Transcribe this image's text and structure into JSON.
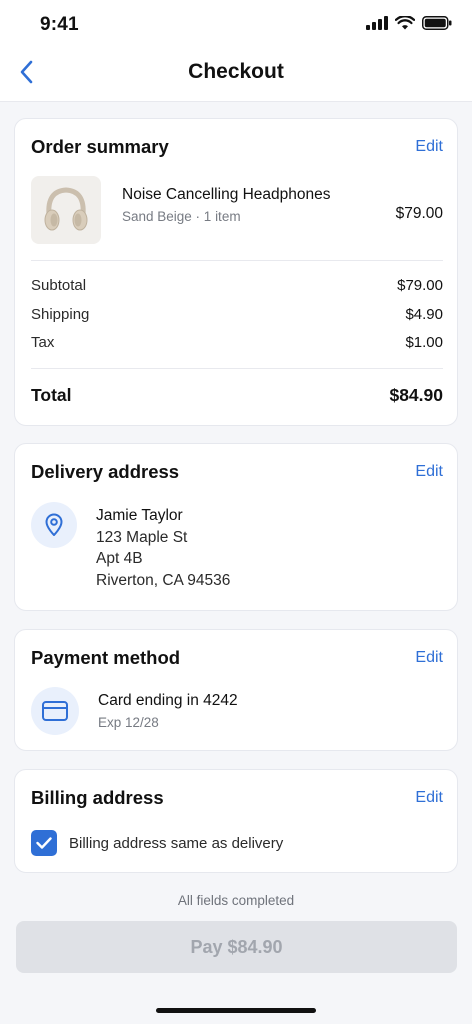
{
  "status_bar": {
    "time": "9:41"
  },
  "nav": {
    "title": "Checkout"
  },
  "order_summary": {
    "title": "Order summary",
    "edit_label": "Edit",
    "item": {
      "name": "Noise Cancelling Headphones",
      "variant": "Sand Beige · 1 item",
      "price": "$79.00"
    },
    "lines": [
      {
        "label": "Subtotal",
        "value": "$79.00"
      },
      {
        "label": "Shipping",
        "value": "$4.90"
      },
      {
        "label": "Tax",
        "value": "$1.00"
      }
    ],
    "total": {
      "label": "Total",
      "value": "$84.90"
    }
  },
  "delivery": {
    "title": "Delivery address",
    "edit_label": "Edit",
    "name": "Jamie Taylor",
    "line1": "123 Maple St",
    "line2": "Apt 4B",
    "line3": "Riverton, CA 94536",
    "icon": "location-pin-icon"
  },
  "payment": {
    "title": "Payment method",
    "edit_label": "Edit",
    "card": "Card ending in 4242",
    "exp": "Exp 12/28",
    "icon": "credit-card-icon"
  },
  "billing": {
    "title": "Billing address",
    "edit_label": "Edit",
    "same_as_delivery_label": "Billing address same as delivery",
    "same_as_delivery": true
  },
  "footer": {
    "status_text": "All fields completed",
    "pay_label": "Pay $84.90"
  },
  "colors": {
    "accent": "#2f6fd6",
    "background": "#f5f6f9",
    "disabled_button": "#dfe1e6"
  }
}
